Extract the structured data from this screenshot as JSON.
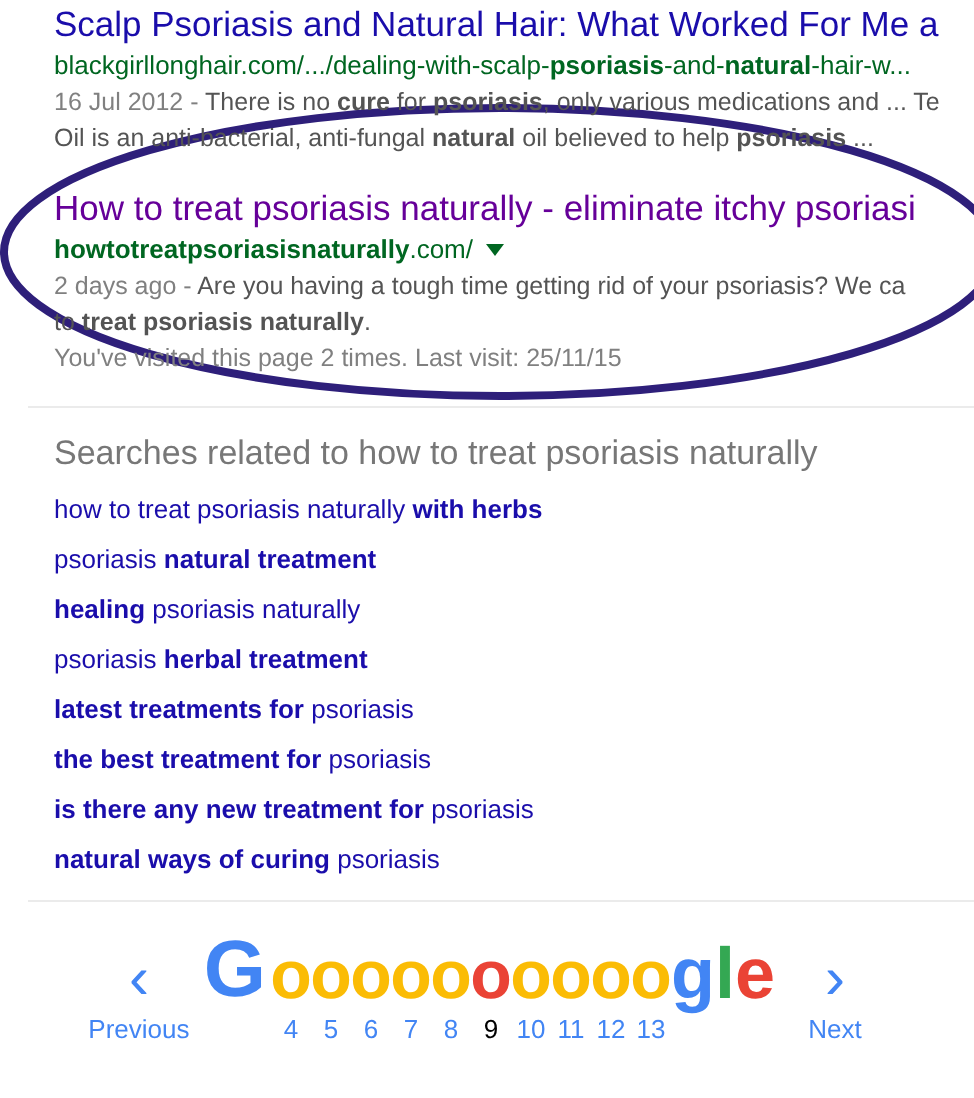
{
  "results": [
    {
      "title": "Scalp Psoriasis and Natural Hair: What Worked For Me a",
      "visited": false,
      "url": "blackgirllonghair.com/.../dealing-with-scalp-**psoriasis**-and-**natural**-hair-w...",
      "date": "16 Jul 2012 - ",
      "snippet": [
        "There is no **cure** for **psoriasis**, only various medications and ... Te",
        "Oil is an anti-bacterial, anti-fungal **natural** oil believed to help **psoriasis** ..."
      ]
    },
    {
      "title": "How to treat psoriasis naturally - eliminate itchy psoriasi",
      "visited": true,
      "url": "**howtotreatpsoriasisnaturally**.com/",
      "has_menu": true,
      "date": "2 days ago - ",
      "snippet": [
        "Are you having a tough time getting rid of your psoriasis? We ca",
        "to **treat psoriasis naturally**."
      ],
      "visit_note": "You've visited this page 2 times. Last visit: 25/11/15"
    }
  ],
  "related": {
    "heading": "Searches related to how to treat psoriasis naturally",
    "items": [
      "how to treat psoriasis naturally **with herbs**",
      "psoriasis **natural treatment**",
      "**healing** psoriasis naturally",
      "psoriasis **herbal treatment**",
      "**latest treatments for** psoriasis",
      "**the best treatment for** psoriasis",
      "**is there any new treatment for** psoriasis",
      "**natural ways of curing** psoriasis"
    ]
  },
  "pagination": {
    "previous": "Previous",
    "next": "Next",
    "prev_arrow": "‹",
    "next_arrow": "›",
    "logo_start": [
      {
        "char": "G",
        "color": "#4285f4"
      }
    ],
    "logo_end": [
      {
        "char": "g",
        "color": "#4285f4"
      },
      {
        "char": "l",
        "color": "#34a853"
      },
      {
        "char": "e",
        "color": "#ea4335"
      }
    ],
    "pages": [
      {
        "letter": "o",
        "number": "4",
        "selected": false
      },
      {
        "letter": "o",
        "number": "5",
        "selected": false
      },
      {
        "letter": "o",
        "number": "6",
        "selected": false
      },
      {
        "letter": "o",
        "number": "7",
        "selected": false
      },
      {
        "letter": "o",
        "number": "8",
        "selected": false
      },
      {
        "letter": "o",
        "number": "9",
        "selected": true
      },
      {
        "letter": "o",
        "number": "10",
        "selected": false
      },
      {
        "letter": "o",
        "number": "11",
        "selected": false
      },
      {
        "letter": "o",
        "number": "12",
        "selected": false
      },
      {
        "letter": "o",
        "number": "13",
        "selected": false
      }
    ]
  }
}
